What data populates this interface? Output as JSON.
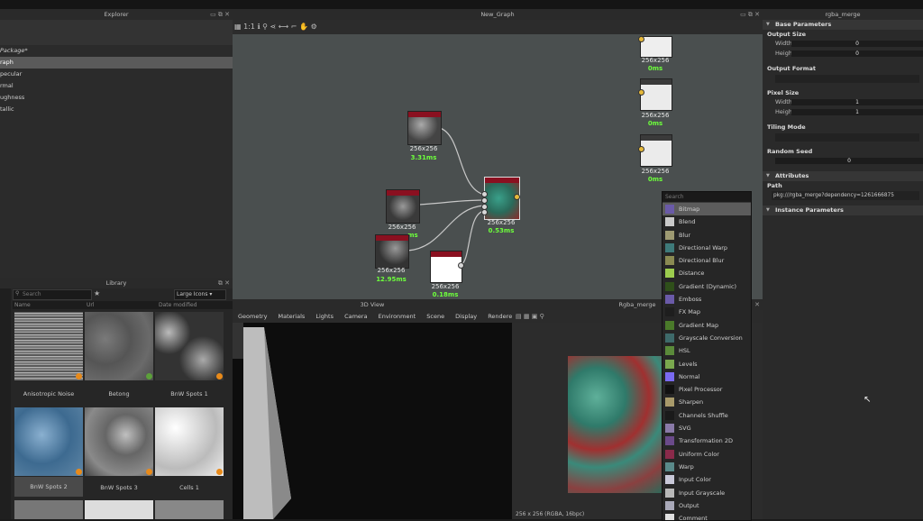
{
  "explorer": {
    "title": "Explorer",
    "items": [
      {
        "label": "Package*",
        "selected": false
      },
      {
        "label": "raph",
        "selected": true
      },
      {
        "label": "pecular",
        "selected": false
      },
      {
        "label": "rmal",
        "selected": false
      },
      {
        "label": "ughness",
        "selected": false
      },
      {
        "label": "tallic",
        "selected": false
      }
    ]
  },
  "library": {
    "title": "Library",
    "search_placeholder": "Search",
    "view_mode": "Large Icons",
    "columns": [
      "Name",
      "Url",
      "Date modified"
    ],
    "items": [
      {
        "label": "Anisotropic Noise",
        "color": "#9a9a9a"
      },
      {
        "label": "Betong",
        "color": "#6e6e6e"
      },
      {
        "label": "BnW Spots 1",
        "color": "#8a8a8a"
      },
      {
        "label": "BnW Spots 2",
        "color": "#5f86a6",
        "selected": true
      },
      {
        "label": "BnW Spots 3",
        "color": "#8d8d8d"
      },
      {
        "label": "Cells 1",
        "color": "#dcdcdc"
      }
    ]
  },
  "graph": {
    "title": "New_Graph",
    "nodes": [
      {
        "size": "256x256",
        "ms": "3.31ms"
      },
      {
        "size": "256x256",
        "ms": "ms"
      },
      {
        "size": "256x256",
        "ms": "12.95ms"
      },
      {
        "size": "256x256",
        "ms": "0.18ms"
      },
      {
        "size": "256x256",
        "ms": "0.53ms"
      },
      {
        "size": "256x256",
        "ms": "0ms"
      },
      {
        "size": "256x256",
        "ms": "0ms"
      },
      {
        "size": "256x256",
        "ms": "0ms"
      }
    ]
  },
  "view3d": {
    "title": "3D View",
    "menu": [
      "Geometry",
      "Materials",
      "Lights",
      "Camera",
      "Environment",
      "Scene",
      "Display",
      "Renderer"
    ]
  },
  "view2d": {
    "title": "Rgba_merge",
    "status": "256 x 256 (RGBA, 16bpc)"
  },
  "properties": {
    "title": "rgba_merge",
    "base_section": "Base Parameters",
    "output_size": "Output Size",
    "width_label": "Width",
    "height_label": "Height",
    "width_val": "0",
    "height_val": "0",
    "output_format": "Output Format",
    "pixel_size": "Pixel Size",
    "px_width_val": "1",
    "px_height_val": "1",
    "tiling_mode": "Tiling Mode",
    "random_seed": "Random Seed",
    "seed_val": "0",
    "attributes_section": "Attributes",
    "path_label": "Path",
    "path_val": "pkg:///rgba_merge?dependency=1261666875",
    "instance_section": "Instance Parameters"
  },
  "dropdown": {
    "search_placeholder": "Search",
    "items": [
      {
        "label": "Bitmap",
        "color": "#6a5aa8",
        "selected": true
      },
      {
        "label": "Blend",
        "color": "#c9c9c9"
      },
      {
        "label": "Blur",
        "color": "#9e9a72"
      },
      {
        "label": "Directional Warp",
        "color": "#3e7a7a"
      },
      {
        "label": "Directional Blur",
        "color": "#8a8a52"
      },
      {
        "label": "Distance",
        "color": "#9ccc4e"
      },
      {
        "label": "Gradient (Dynamic)",
        "color": "#2f4f1a"
      },
      {
        "label": "Emboss",
        "color": "#6a5aa8"
      },
      {
        "label": "FX Map",
        "color": "#1e1e1e"
      },
      {
        "label": "Gradient Map",
        "color": "#4a7a2a"
      },
      {
        "label": "Grayscale Conversion",
        "color": "#3e6a6a"
      },
      {
        "label": "HSL",
        "color": "#5a8a3a"
      },
      {
        "label": "Levels",
        "color": "#7aa84e"
      },
      {
        "label": "Normal",
        "color": "#7a6af0"
      },
      {
        "label": "Pixel Processor",
        "color": "#111111"
      },
      {
        "label": "Sharpen",
        "color": "#a89a6a"
      },
      {
        "label": "Channels Shuffle",
        "color": "#1a1a1a"
      },
      {
        "label": "SVG",
        "color": "#8a7aa8"
      },
      {
        "label": "Transformation 2D",
        "color": "#6a4a8a"
      },
      {
        "label": "Uniform Color",
        "color": "#8a2a4a"
      },
      {
        "label": "Warp",
        "color": "#5a8a8a"
      },
      {
        "label": "Input Color",
        "color": "#c8c8d8"
      },
      {
        "label": "Input Grayscale",
        "color": "#b8b8b8"
      },
      {
        "label": "Output",
        "color": "#a8a8b8"
      },
      {
        "label": "Comment",
        "color": "#e0e0e0"
      }
    ]
  }
}
